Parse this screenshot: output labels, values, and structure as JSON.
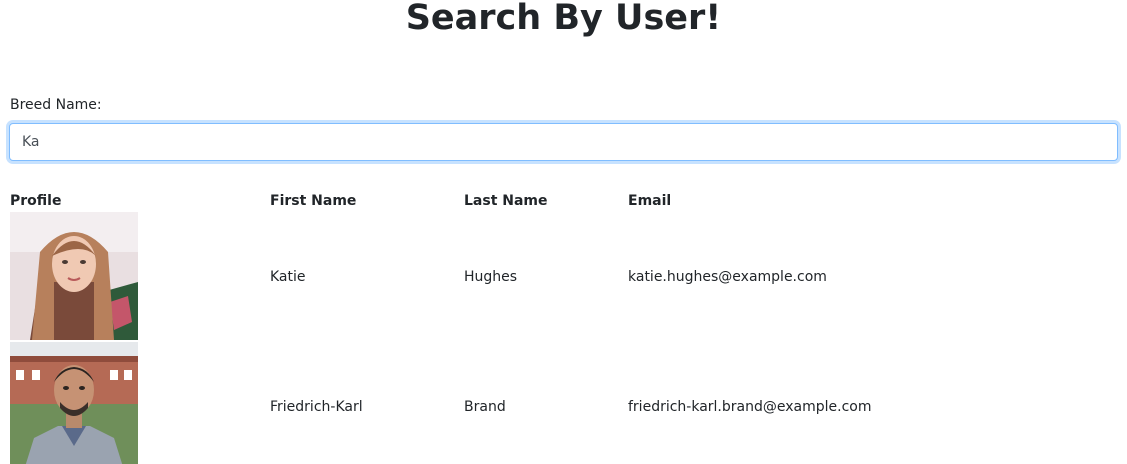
{
  "page": {
    "title": "Search By User!"
  },
  "search": {
    "label": "Breed Name:",
    "value": "Ka"
  },
  "table": {
    "headers": [
      "Profile",
      "First Name",
      "Last Name",
      "Email"
    ],
    "rows": [
      {
        "first_name": "Katie",
        "last_name": "Hughes",
        "email": "katie.hughes@example.com",
        "avatar": "profile-photo"
      },
      {
        "first_name": "Friedrich-Karl",
        "last_name": "Brand",
        "email": "friedrich-karl.brand@example.com",
        "avatar": "profile-photo"
      }
    ]
  }
}
